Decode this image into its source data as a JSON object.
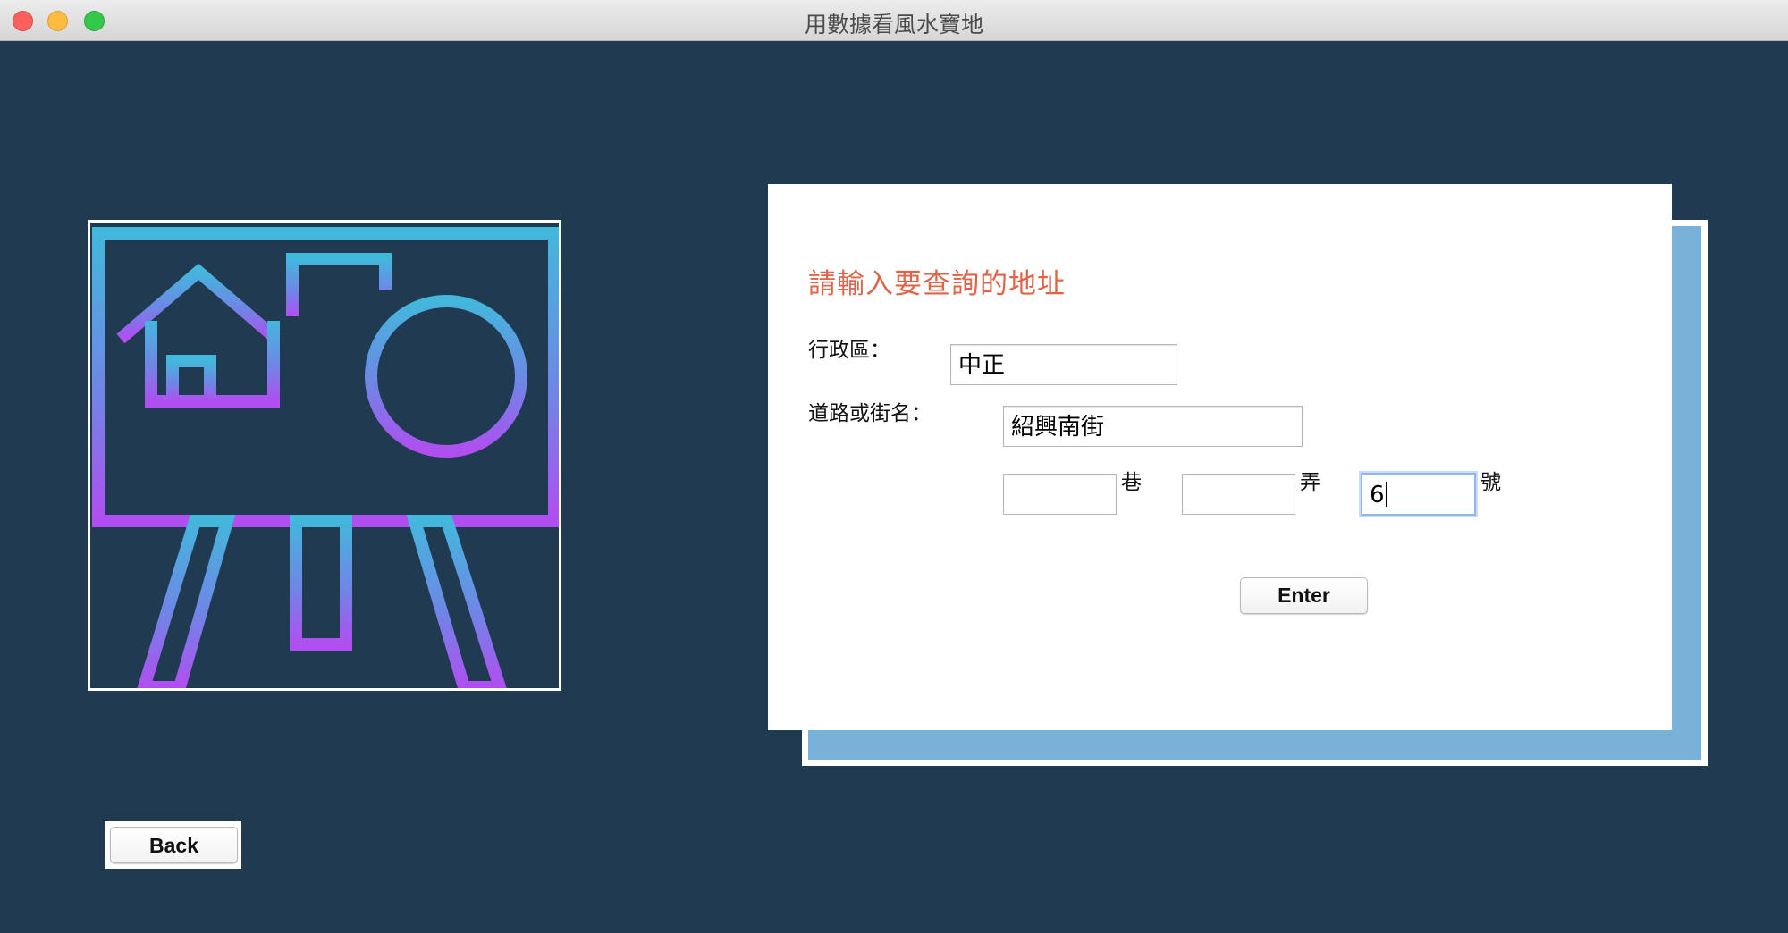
{
  "window": {
    "title": "用數據看風水寶地",
    "controls": [
      "close",
      "minimize",
      "zoom"
    ]
  },
  "illustration": {
    "icon": "presentation-board-icon",
    "description_icons": [
      "house-icon",
      "bar-chart-icon",
      "pie-chart-icon"
    ],
    "gradient": [
      "#43b7dc",
      "#b14ef0"
    ]
  },
  "form": {
    "heading": "請輸入要查詢的地址",
    "district_label": "行政區：",
    "district_value": "中正",
    "road_label": "道路或街名：",
    "road_value": "紹興南街",
    "lane_value": "",
    "lane_unit": "巷",
    "alley_value": "",
    "alley_unit": "弄",
    "number_value": "6",
    "number_unit": "號",
    "enter_label": "Enter"
  },
  "nav": {
    "back_label": "Back"
  },
  "colors": {
    "background": "#203b51",
    "heading": "#e0634a",
    "card_shadow": "#78b2d9",
    "focus_ring": "#8fb8ea"
  }
}
